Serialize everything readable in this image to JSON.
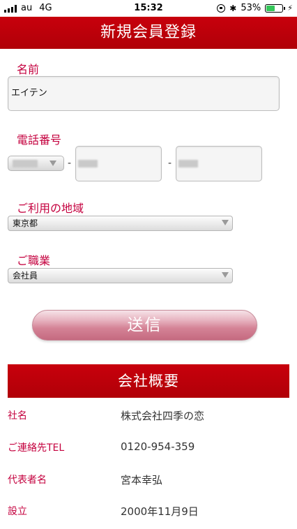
{
  "status": {
    "carrier": "au",
    "network": "4G",
    "time": "15:32",
    "battery": "53%",
    "battery_level": 0.53
  },
  "header": {
    "title": "新規会員登録"
  },
  "form": {
    "name_label": "名前",
    "name_value": "エイテン",
    "phone_label": "電話番号",
    "phone_dash": "-",
    "region_label": "ご利用の地域",
    "region_value": "東京都",
    "job_label": "ご職業",
    "job_value": "会社員",
    "submit_label": "送信"
  },
  "company": {
    "title": "会社概要",
    "rows": [
      {
        "key": "社名",
        "value": "株式会社四季の恋"
      },
      {
        "key": "ご連絡先TEL",
        "value": "0120-954-359"
      },
      {
        "key": "代表者名",
        "value": "宮本幸弘"
      },
      {
        "key": "設立",
        "value": "2000年11月9日"
      }
    ]
  },
  "colors": {
    "brand_red": "#c8000c",
    "label_pink": "#c4003e",
    "submit_pink": "#d48396"
  }
}
